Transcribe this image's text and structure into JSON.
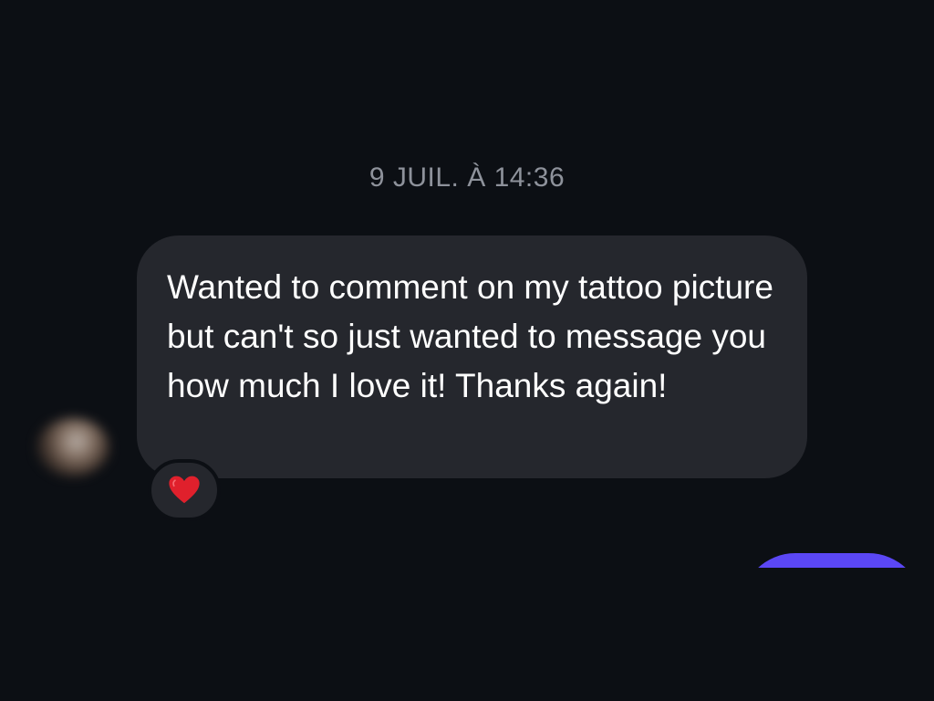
{
  "conversation": {
    "timestamp": "9 JUIL. À 14:36",
    "messages": [
      {
        "direction": "received",
        "text": "Wanted to comment on my tattoo picture but can't so just wanted to message you how much I love it! Thanks again!",
        "reaction": "heart-icon"
      }
    ]
  },
  "colors": {
    "background": "#0c0f14",
    "received_bubble": "#25272d",
    "sent_bubble": "#5b47f5",
    "timestamp_text": "#8e929b",
    "reaction_heart": "#e0202c"
  }
}
